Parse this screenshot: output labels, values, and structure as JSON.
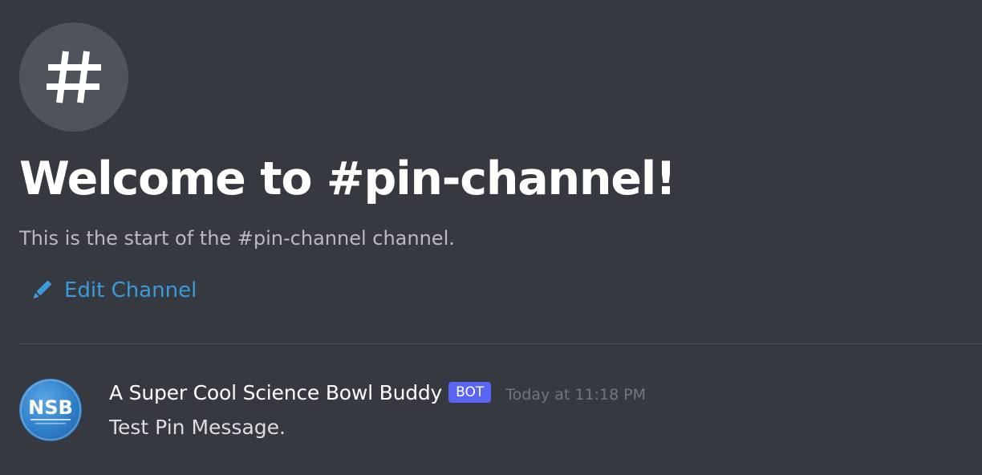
{
  "channel": {
    "icon": "hashtag-icon",
    "welcome_title": "Welcome to #pin-channel!",
    "welcome_subtitle": "This is the start of the #pin-channel channel.",
    "edit_label": "Edit Channel",
    "edit_icon": "pencil-icon"
  },
  "message": {
    "avatar_icon": "nsb-logo",
    "avatar_text": "NSB",
    "username": "A Super Cool Science Bowl Buddy",
    "bot_tag": "BOT",
    "timestamp": "Today at 11:18 PM",
    "content": "Test Pin Message."
  },
  "colors": {
    "background": "#36393f",
    "accent_link": "#3b9ad9",
    "bot_tag": "#5865f2",
    "timestamp": "#72767d"
  }
}
